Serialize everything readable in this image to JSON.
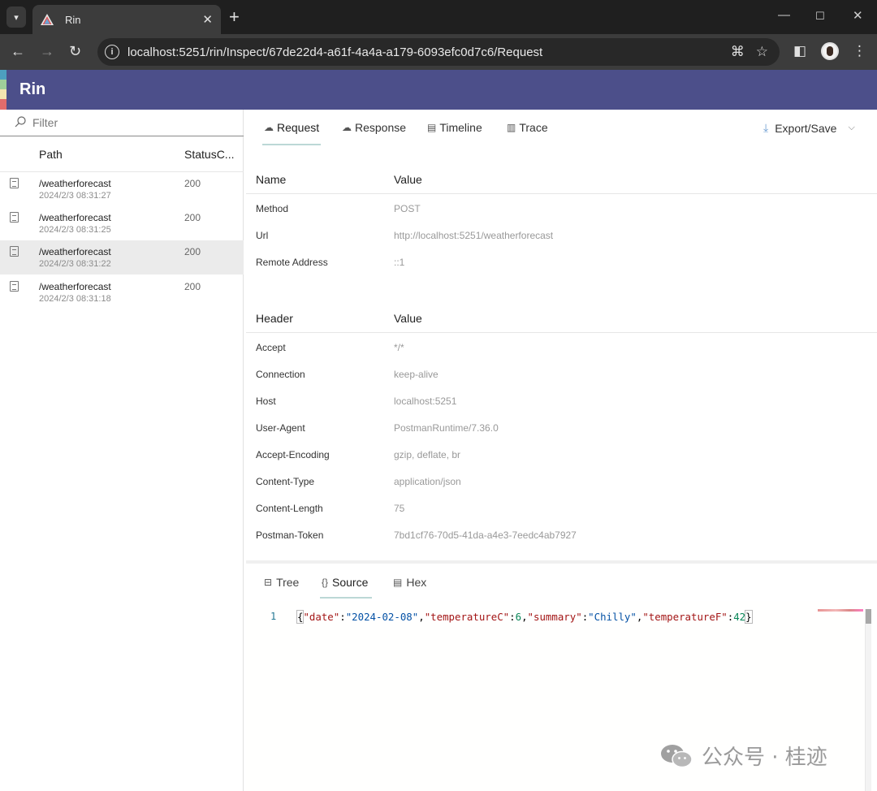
{
  "browser": {
    "tab_title": "Rin",
    "url": "localhost:5251/rin/Inspect/67de22d4-a61f-4a4a-a179-6093efc0d7c6/Request"
  },
  "app": {
    "title": "Rin",
    "stripe_colors": [
      "#4d9fbf",
      "#9fcf9a",
      "#f4e4b0",
      "#e06c6c"
    ]
  },
  "sidebar": {
    "filter_placeholder": "Filter",
    "columns": [
      "Path",
      "StatusC..."
    ],
    "rows": [
      {
        "path": "/weatherforecast",
        "time": "2024/2/3 08:31:27",
        "status": "200",
        "selected": false
      },
      {
        "path": "/weatherforecast",
        "time": "2024/2/3 08:31:25",
        "status": "200",
        "selected": false
      },
      {
        "path": "/weatherforecast",
        "time": "2024/2/3 08:31:22",
        "status": "200",
        "selected": true
      },
      {
        "path": "/weatherforecast",
        "time": "2024/2/3 08:31:18",
        "status": "200",
        "selected": false
      }
    ]
  },
  "main": {
    "tabs": [
      {
        "label": "Request",
        "icon": "cloud-upload-icon"
      },
      {
        "label": "Response",
        "icon": "cloud-download-icon"
      },
      {
        "label": "Timeline",
        "icon": "timeline-icon"
      },
      {
        "label": "Trace",
        "icon": "trace-icon"
      }
    ],
    "export_label": "Export/Save",
    "general": {
      "header": {
        "name": "Name",
        "value": "Value"
      },
      "rows": [
        {
          "name": "Method",
          "value": "POST"
        },
        {
          "name": "Url",
          "value": "http://localhost:5251/weatherforecast"
        },
        {
          "name": "Remote Address",
          "value": "::1"
        }
      ]
    },
    "headers": {
      "header": {
        "name": "Header",
        "value": "Value"
      },
      "rows": [
        {
          "name": "Accept",
          "value": "*/*"
        },
        {
          "name": "Connection",
          "value": "keep-alive"
        },
        {
          "name": "Host",
          "value": "localhost:5251"
        },
        {
          "name": "User-Agent",
          "value": "PostmanRuntime/7.36.0"
        },
        {
          "name": "Accept-Encoding",
          "value": "gzip, deflate, br"
        },
        {
          "name": "Content-Type",
          "value": "application/json"
        },
        {
          "name": "Content-Length",
          "value": "75"
        },
        {
          "name": "Postman-Token",
          "value": "7bd1cf76-70d5-41da-a4e3-7eedc4ab7927"
        }
      ]
    },
    "body_tabs": [
      {
        "label": "Tree",
        "icon": "tree-icon"
      },
      {
        "label": "Source",
        "icon": "braces-icon"
      },
      {
        "label": "Hex",
        "icon": "hex-icon"
      }
    ],
    "editor": {
      "line_number": "1",
      "json": {
        "open": "{",
        "k1": "\"date\"",
        "v1": "\"2024-02-08\"",
        "k2": "\"temperatureC\"",
        "v2": "6",
        "k3": "\"summary\"",
        "v3": "\"Chilly\"",
        "k4": "\"temperatureF\"",
        "v4": "42",
        "close": "}"
      }
    }
  },
  "watermark": {
    "text": "公众号 · 桂迹"
  }
}
